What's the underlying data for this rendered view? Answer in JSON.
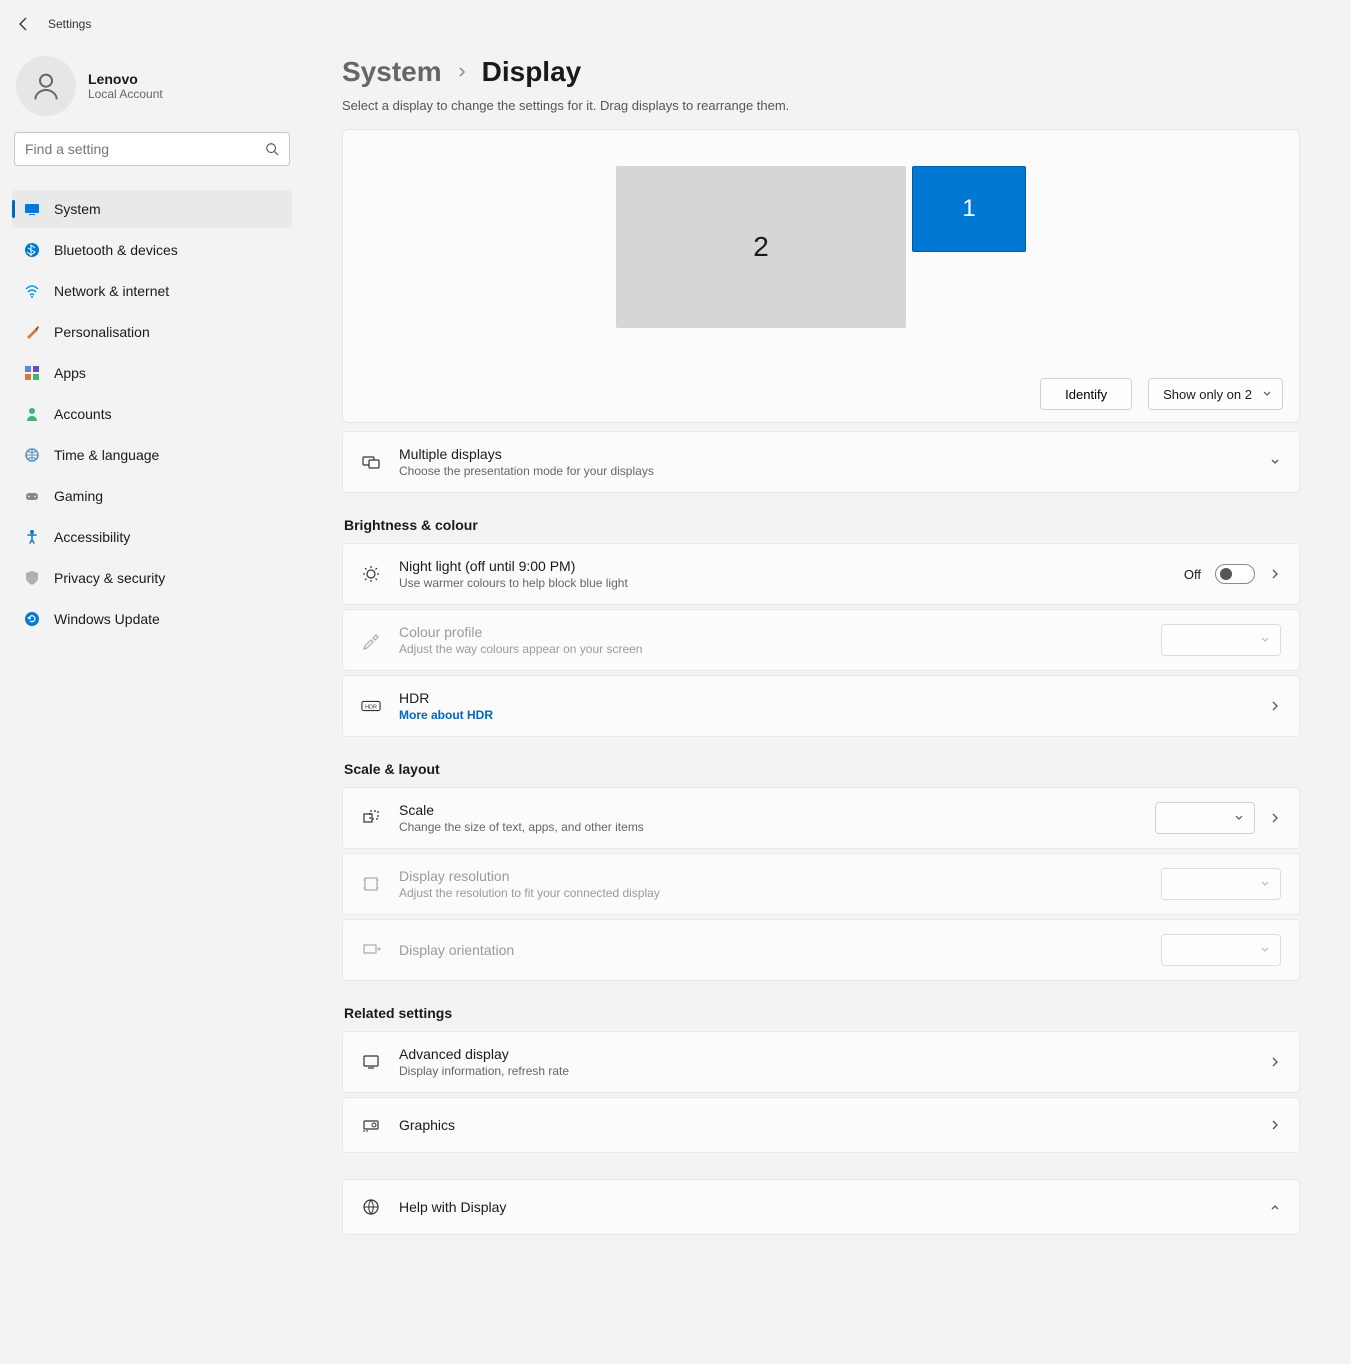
{
  "titlebar": {
    "app_name": "Settings"
  },
  "profile": {
    "name": "Lenovo",
    "subtitle": "Local Account"
  },
  "search": {
    "placeholder": "Find a setting"
  },
  "nav": {
    "items": [
      {
        "label": "System",
        "icon": "display-icon",
        "active": true
      },
      {
        "label": "Bluetooth & devices",
        "icon": "bluetooth-icon"
      },
      {
        "label": "Network & internet",
        "icon": "wifi-icon"
      },
      {
        "label": "Personalisation",
        "icon": "brush-icon"
      },
      {
        "label": "Apps",
        "icon": "apps-icon"
      },
      {
        "label": "Accounts",
        "icon": "person-icon"
      },
      {
        "label": "Time & language",
        "icon": "globe-clock-icon"
      },
      {
        "label": "Gaming",
        "icon": "gamepad-icon"
      },
      {
        "label": "Accessibility",
        "icon": "accessibility-icon"
      },
      {
        "label": "Privacy & security",
        "icon": "shield-icon"
      },
      {
        "label": "Windows Update",
        "icon": "update-icon"
      }
    ]
  },
  "breadcrumb": {
    "parent": "System",
    "current": "Display"
  },
  "page_subtitle": "Select a display to change the settings for it. Drag displays to rearrange them.",
  "monitors": {
    "monitor1_label": "1",
    "monitor2_label": "2",
    "identify_label": "Identify",
    "mode_dropdown": "Show only on 2"
  },
  "multi_displays": {
    "title": "Multiple displays",
    "subtitle": "Choose the presentation mode for your displays"
  },
  "sections": {
    "brightness": "Brightness & colour",
    "scale": "Scale & layout",
    "related": "Related settings"
  },
  "night_light": {
    "title": "Night light (off until 9:00 PM)",
    "subtitle": "Use warmer colours to help block blue light",
    "state": "Off"
  },
  "colour_profile": {
    "title": "Colour profile",
    "subtitle": "Adjust the way colours appear on your screen",
    "value": ""
  },
  "hdr": {
    "title": "HDR",
    "link": "More about HDR"
  },
  "scale_item": {
    "title": "Scale",
    "subtitle": "Change the size of text, apps, and other items",
    "value": ""
  },
  "resolution": {
    "title": "Display resolution",
    "subtitle": "Adjust the resolution to fit your connected display",
    "value": ""
  },
  "orientation": {
    "title": "Display orientation",
    "value": ""
  },
  "advanced": {
    "title": "Advanced display",
    "subtitle": "Display information, refresh rate"
  },
  "graphics": {
    "title": "Graphics"
  },
  "help": {
    "title": "Help with Display"
  }
}
